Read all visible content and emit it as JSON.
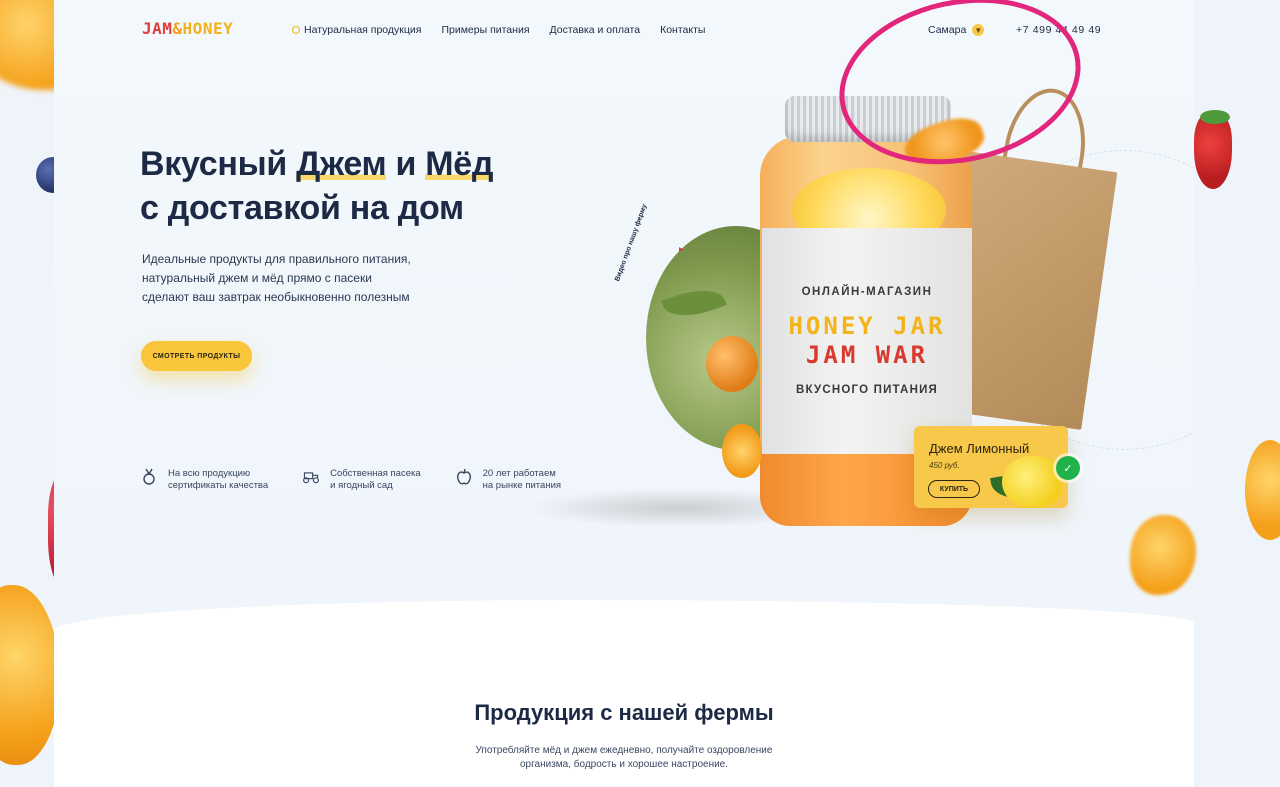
{
  "header": {
    "logo": {
      "part1": "JAM",
      "amp": "&",
      "part2": "HONEY"
    },
    "nav": [
      {
        "label": "Натуральная продукция"
      },
      {
        "label": "Примеры питания"
      },
      {
        "label": "Доставка и оплата"
      },
      {
        "label": "Контакты"
      }
    ],
    "city": "Самара",
    "phone": "+7 499 44 49 49"
  },
  "hero": {
    "title_line1_a": "Вкусный ",
    "title_line1_hl1": "Джем",
    "title_line1_b": " и ",
    "title_line1_hl2": "Мёд",
    "title_line2": "с доставкой на дом",
    "desc": [
      "Идеальные продукты для правильного питания,",
      "натуральный джем и мёд прямо с пасеки",
      "сделают ваш завтрак необыкновенно полезным"
    ],
    "cta": "Смотреть продукты",
    "video_label": "Видео про нашу ферму"
  },
  "features": [
    {
      "icon": "medal-icon",
      "line1": "На всю продукцию",
      "line2": "сертификаты качества"
    },
    {
      "icon": "tractor-icon",
      "line1": "Собственная пасека",
      "line2": "и ягодный сад"
    },
    {
      "icon": "apple-icon",
      "line1": "20 лет работаем",
      "line2": "на рынке питания"
    }
  ],
  "jar_label": {
    "top": "ОНЛАЙН-МАГАЗИН",
    "honey": "HONEY JAR",
    "jam": "JAM WAR",
    "bottom": "ВКУСНОГО ПИТАНИЯ"
  },
  "product_card": {
    "name": "Джем Лимонный",
    "price": "450 руб.",
    "buy": "КУПИТЬ"
  },
  "section": {
    "title": "Продукция с нашей фермы",
    "desc_line1": "Употребляйте мёд и джем ежедневно, получайте оздоровление",
    "desc_line2": "организма, бодрость и хорошее настроение."
  },
  "colors": {
    "accent": "#f9c53a",
    "annotation": "#e2267c",
    "logo_red": "#e23b3b",
    "title": "#1c2a45"
  }
}
